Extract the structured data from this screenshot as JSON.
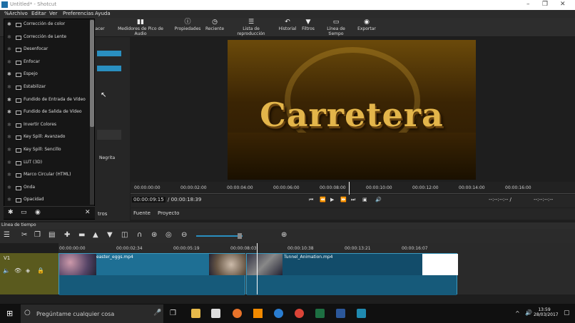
{
  "window": {
    "title": "Untitled* - Shotcut",
    "minimize": "–",
    "maximize": "❐",
    "close": "✕"
  },
  "menu": [
    "%Archivo",
    "Editar",
    "Ver",
    "Preferencias",
    "Ayuda"
  ],
  "toolbar": [
    {
      "label": "Medidores de Pico de Audio",
      "icon": "audio-meter-icon"
    },
    {
      "label": "Propiedades",
      "icon": "info-icon"
    },
    {
      "label": "Reciente",
      "icon": "clock-icon"
    },
    {
      "label": "Lista de reproducción",
      "icon": "list-icon"
    },
    {
      "label": "Historial",
      "icon": "history-icon"
    },
    {
      "label": "Filtros",
      "icon": "filter-icon"
    },
    {
      "label": "Línea de tiempo",
      "icon": "timeline-icon"
    },
    {
      "label": "Exportar",
      "icon": "export-icon"
    }
  ],
  "toolbar_partial": "acer",
  "filters": [
    {
      "label": "Corrección de color",
      "fav": true
    },
    {
      "label": "Corrección de Lente",
      "fav": false
    },
    {
      "label": "Desenfocar",
      "fav": false
    },
    {
      "label": "Enfocar",
      "fav": false
    },
    {
      "label": "Espejo",
      "fav": true
    },
    {
      "label": "Estabilizar",
      "fav": false
    },
    {
      "label": "Fundido de Entrada de Vídeo",
      "fav": true
    },
    {
      "label": "Fundido de Salida de Vídeo",
      "fav": true
    },
    {
      "label": "Invertir Colores",
      "fav": false
    },
    {
      "label": "Key Spill: Avanzado",
      "fav": false
    },
    {
      "label": "Key Spill: Sencillo",
      "fav": false
    },
    {
      "label": "LUT (3D)",
      "fav": false
    },
    {
      "label": "Marco Circular (HTML)",
      "fav": false
    },
    {
      "label": "Onda",
      "fav": false
    },
    {
      "label": "Opacidad",
      "fav": false
    }
  ],
  "left_panel": {
    "negrita": "Negrita",
    "tab_partial": "tros"
  },
  "preview": {
    "text": "Carretera"
  },
  "ruler": [
    "00:00:00:00",
    "00:00:02:00",
    "00:00:04:00",
    "00:00:06:00",
    "00:00:08:00",
    "00:00:10:00",
    "00:00:12:00",
    "00:00:14:00",
    "00:00:16:00"
  ],
  "transport": {
    "current": "00:00:09:15",
    "total": "/ 00:00:18:39",
    "in_out": "--:--:--:-- /",
    "out": "--:--:--:--"
  },
  "source_tabs": [
    "Fuente",
    "Proyecto"
  ],
  "timeline": {
    "header": "Línea de tiempo",
    "ruler": [
      "00:00:00:00",
      "00:00:02:34",
      "00:00:05:19",
      "00:00:08:03",
      "00:00:10:38",
      "00:00:13:21",
      "00:00:16:07"
    ],
    "track": "V1",
    "clips": [
      "easter_eggs.mp4",
      "Tunnel_Animation.mp4"
    ]
  },
  "taskbar": {
    "search": "Pregúntame cualquier cosa",
    "time": "13:59",
    "date": "28/03/2017"
  }
}
